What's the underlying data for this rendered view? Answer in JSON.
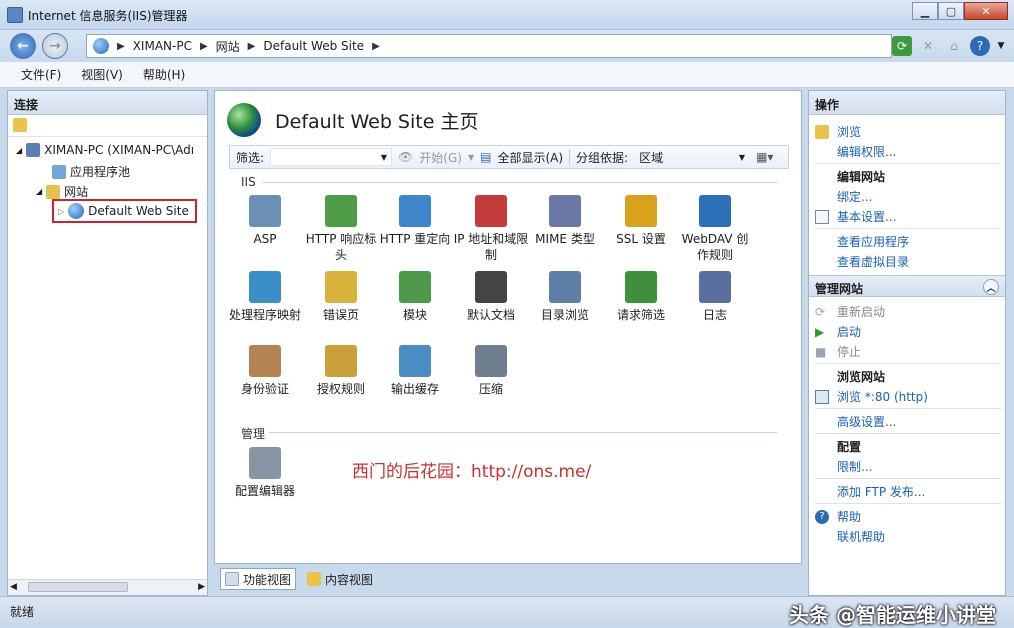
{
  "window": {
    "title": "Internet 信息服务(IIS)管理器"
  },
  "address": {
    "crumbs": [
      "XIMAN-PC",
      "网站",
      "Default Web Site"
    ]
  },
  "menu": [
    {
      "label": "文件(F)"
    },
    {
      "label": "视图(V)"
    },
    {
      "label": "帮助(H)"
    }
  ],
  "left_pane": {
    "header": "连接",
    "tree": {
      "server": "XIMAN-PC (XIMAN-PC\\Adı",
      "app_pools": "应用程序池",
      "sites": "网站",
      "selected_site": "Default Web Site"
    }
  },
  "center": {
    "title": "Default Web Site 主页",
    "filter": {
      "label": "筛选:",
      "start": "开始(G)",
      "show_all": "全部显示(A)",
      "group_by_label": "分组依据:",
      "group_by_value": "区域"
    },
    "sections": [
      {
        "label": "IIS",
        "items": [
          {
            "label": "ASP",
            "icon": "asp-icon",
            "color": "#6c8fb8"
          },
          {
            "label": "HTTP 响应标头",
            "icon": "http-response-headers-icon",
            "color": "#4f9c46"
          },
          {
            "label": "HTTP 重定向",
            "icon": "http-redirect-icon",
            "color": "#3e86c9"
          },
          {
            "label": "IP 地址和域限制",
            "icon": "ip-restrictions-icon",
            "color": "#c33b3b"
          },
          {
            "label": "MIME 类型",
            "icon": "mime-types-icon",
            "color": "#6a78a8"
          },
          {
            "label": "SSL 设置",
            "icon": "ssl-lock-icon",
            "color": "#d9a21c"
          },
          {
            "label": "WebDAV 创作规则",
            "icon": "webdav-icon",
            "color": "#2c6fb7"
          },
          {
            "label": "处理程序映射",
            "icon": "handler-mappings-icon",
            "color": "#3a8fc9"
          },
          {
            "label": "错误页",
            "icon": "error-pages-icon",
            "color": "#d8b23a"
          },
          {
            "label": "模块",
            "icon": "modules-icon",
            "color": "#4c9a4a"
          },
          {
            "label": "默认文档",
            "icon": "default-document-icon",
            "color": "#444444"
          },
          {
            "label": "目录浏览",
            "icon": "directory-browsing-icon",
            "color": "#5f7fa8"
          },
          {
            "label": "请求筛选",
            "icon": "request-filtering-icon",
            "color": "#3f8f3c"
          },
          {
            "label": "日志",
            "icon": "logging-icon",
            "color": "#5a6fa0"
          },
          {
            "label": "身份验证",
            "icon": "authentication-icon",
            "color": "#b48552"
          },
          {
            "label": "授权规则",
            "icon": "authorization-rules-icon",
            "color": "#caa03a"
          },
          {
            "label": "输出缓存",
            "icon": "output-caching-icon",
            "color": "#4a8cc4"
          },
          {
            "label": "压缩",
            "icon": "compression-icon",
            "color": "#6f7f8f"
          }
        ]
      },
      {
        "label": "管理",
        "items": [
          {
            "label": "配置编辑器",
            "icon": "configuration-editor-icon",
            "color": "#8895a5"
          }
        ]
      }
    ],
    "watermark": "西门的后花园：http://ons.me/"
  },
  "view_tabs": {
    "features": "功能视图",
    "content": "内容视图"
  },
  "actions": {
    "header": "操作",
    "browse": "浏览",
    "edit_permissions": "编辑权限...",
    "edit_site": "编辑网站",
    "bindings": "绑定...",
    "basic_settings": "基本设置...",
    "view_applications": "查看应用程序",
    "view_virtual_dirs": "查看虚拟目录",
    "manage_site": "管理网站",
    "restart": "重新启动",
    "start": "启动",
    "stop": "停止",
    "browse_site": "浏览网站",
    "browse_80": "浏览 *:80 (http)",
    "advanced_settings": "高级设置...",
    "config": "配置",
    "limits": "限制...",
    "add_ftp": "添加 FTP 发布...",
    "help": "帮助",
    "online_help": "联机帮助"
  },
  "status": {
    "text": "就绪"
  },
  "brand_watermark": "头条 @智能运维小讲堂"
}
